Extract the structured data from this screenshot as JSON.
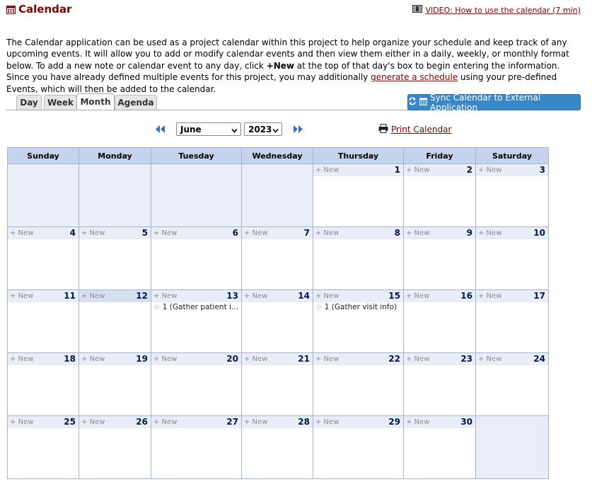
{
  "header": {
    "title": "Calendar",
    "video_label": "VIDEO: How to use the calendar (7 min)"
  },
  "intro": {
    "p1": "The Calendar application can be used as a project calendar within this project to help organize your schedule and keep track of any upcoming events. It will allow you to add or modify calendar events and then view them either in a daily, weekly, or monthly format below. To add a new note or calendar event to any day, click ",
    "new_bold": "+New",
    "p2": " at the top of that day's box to begin entering the information. Since you have already defined multiple events for this project, you may additionally ",
    "link": "generate a schedule",
    "p3": " using your pre-defined Events, which will then be added to the calendar."
  },
  "tabs": [
    "Day",
    "Week",
    "Month",
    "Agenda"
  ],
  "active_tab": "Month",
  "sync_button": "Sync Calendar to External Application",
  "nav": {
    "month": "June",
    "year": "2023",
    "print_label": "Print Calendar"
  },
  "weekdays": [
    "Sunday",
    "Monday",
    "Tuesday",
    "Wednesday",
    "Thursday",
    "Friday",
    "Saturday"
  ],
  "new_label": "+ New",
  "weeks": [
    [
      null,
      null,
      null,
      null,
      {
        "day": "1"
      },
      {
        "day": "2"
      },
      {
        "day": "3"
      }
    ],
    [
      {
        "day": "4"
      },
      {
        "day": "5"
      },
      {
        "day": "6"
      },
      {
        "day": "7"
      },
      {
        "day": "8"
      },
      {
        "day": "9"
      },
      {
        "day": "10"
      }
    ],
    [
      {
        "day": "11"
      },
      {
        "day": "12",
        "today": true
      },
      {
        "day": "13",
        "event": "1 (Gather patient i..."
      },
      {
        "day": "14"
      },
      {
        "day": "15",
        "event": "1 (Gather visit info)"
      },
      {
        "day": "16"
      },
      {
        "day": "17"
      }
    ],
    [
      {
        "day": "18"
      },
      {
        "day": "19"
      },
      {
        "day": "20"
      },
      {
        "day": "21"
      },
      {
        "day": "22"
      },
      {
        "day": "23"
      },
      {
        "day": "24"
      }
    ],
    [
      {
        "day": "25"
      },
      {
        "day": "26"
      },
      {
        "day": "27"
      },
      {
        "day": "28"
      },
      {
        "day": "29"
      },
      {
        "day": "30"
      },
      null
    ]
  ],
  "colors": {
    "accent": "#800000",
    "header_bg": "#c5d3ec",
    "today_bg": "#ffffcc",
    "sync_bg": "#3a87c8"
  }
}
